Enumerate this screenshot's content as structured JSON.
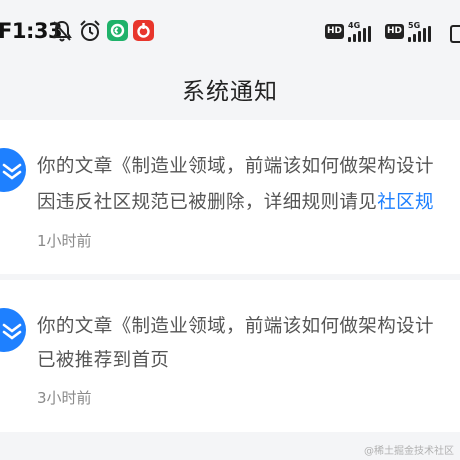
{
  "status_bar": {
    "time": "F1:33",
    "left_icons": [
      "bell-off-icon",
      "alarm-icon",
      "green-app-icon",
      "red-app-icon"
    ],
    "network_1": "4G",
    "network_2": "5G",
    "hd_label": "HD"
  },
  "header": {
    "title": "系统通知"
  },
  "notifications": [
    {
      "line1": "你的文章《制造业领域，前端该如何做架构设计",
      "line2_text": "因违反社区规范已被删除，详细规则请见",
      "line2_link": "社区规",
      "time": "1小时前",
      "icon": "juejin-logo-icon"
    },
    {
      "line1": "你的文章《制造业领域，前端该如何做架构设计",
      "line2_text": "已被推荐到首页",
      "time": "3小时前",
      "icon": "juejin-logo-icon"
    }
  ],
  "watermark": "@稀土掘金技术社区",
  "colors": {
    "accent": "#1e80ff",
    "background": "#f4f5f7",
    "card": "#ffffff"
  }
}
